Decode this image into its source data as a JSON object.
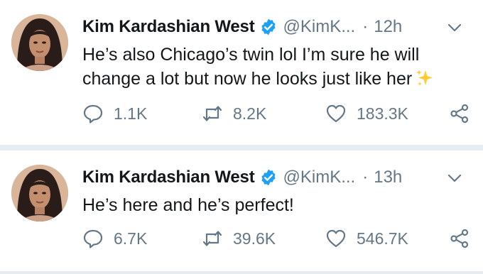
{
  "tweets": [
    {
      "name": "Kim Kardashian West",
      "handle": "@KimK...",
      "separator": "·",
      "time": "12h",
      "text": "He’s also Chicago’s twin lol I’m sure he will change a lot but now he looks just like her",
      "emoji_icon": "sparkles-icon",
      "replies": "1.1K",
      "retweets": "8.2K",
      "likes": "183.3K"
    },
    {
      "name": "Kim Kardashian West",
      "handle": "@KimK...",
      "separator": "·",
      "time": "13h",
      "text": "He’s here and he’s perfect!",
      "replies": "6.7K",
      "retweets": "39.6K",
      "likes": "546.7K"
    }
  ],
  "colors": {
    "accent": "#1da1f2",
    "muted": "#657786",
    "text": "#14171a",
    "divider": "#e6ecf0",
    "sparkle": "#ffcc33"
  },
  "icons": [
    "verified-badge-icon",
    "chevron-down-icon",
    "reply-icon",
    "retweet-icon",
    "like-heart-icon",
    "share-icon"
  ]
}
